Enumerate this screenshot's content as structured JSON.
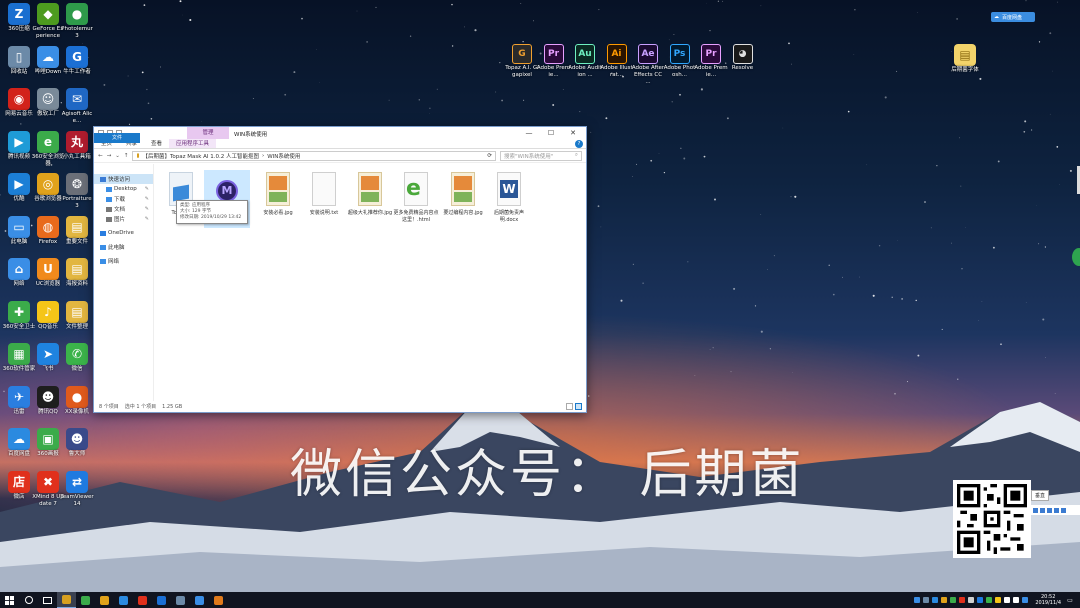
{
  "desktop": {
    "left_icons": [
      {
        "label": "360压缩",
        "color": "#1a6fd0",
        "glyph": "Z"
      },
      {
        "label": "GeForce Experience",
        "color": "#4d9b1f",
        "glyph": "◆"
      },
      {
        "label": "Photolemur 3",
        "color": "#2e9a4a",
        "glyph": "●"
      },
      {
        "label": "回收站",
        "color": "#6c8aa8",
        "glyph": "▯"
      },
      {
        "label": "哔哩Down",
        "color": "#3a8ee6",
        "glyph": "☁"
      },
      {
        "label": "牛牛工作者",
        "color": "#1b6fd4",
        "glyph": "G"
      },
      {
        "label": "网易云音乐",
        "color": "#d2221a",
        "glyph": "◉"
      },
      {
        "label": "傲软工厂",
        "color": "#7a8a99",
        "glyph": "☺"
      },
      {
        "label": "Agisoft Alice...",
        "color": "#1f67c4",
        "glyph": "✉"
      },
      {
        "label": "腾讯视频",
        "color": "#1e9bd7",
        "glyph": "▶"
      },
      {
        "label": "360安全浏览器",
        "color": "#3bab4a",
        "glyph": "e"
      },
      {
        "label": "小丸工具箱",
        "color": "#b01c2e",
        "glyph": "丸"
      },
      {
        "label": "优酷",
        "color": "#1c7fd6",
        "glyph": "▶"
      },
      {
        "label": "谷歌浏览器",
        "color": "#e0a21b",
        "glyph": "◎"
      },
      {
        "label": "Portraiture 3",
        "color": "#6b6f78",
        "glyph": "❂"
      },
      {
        "label": "此电脑",
        "color": "#3a8ee6",
        "glyph": "▭"
      },
      {
        "label": "Firefox",
        "color": "#e86a1c",
        "glyph": "◍"
      },
      {
        "label": "重要文件",
        "color": "#e2b640",
        "glyph": "▤"
      },
      {
        "label": "网络",
        "color": "#3a8ee6",
        "glyph": "⌂"
      },
      {
        "label": "UC浏览器",
        "color": "#f08a1c",
        "glyph": "U"
      },
      {
        "label": "海报资料",
        "color": "#e2b640",
        "glyph": "▤"
      },
      {
        "label": "360安全卫士",
        "color": "#3bab4a",
        "glyph": "✚"
      },
      {
        "label": "QQ音乐",
        "color": "#f5c518",
        "glyph": "♪"
      },
      {
        "label": "文件整理",
        "color": "#e2b640",
        "glyph": "▤"
      },
      {
        "label": "360软件管家",
        "color": "#3bab4a",
        "glyph": "▦"
      },
      {
        "label": "飞书",
        "color": "#1f83e0",
        "glyph": "➤"
      },
      {
        "label": "微信",
        "color": "#3bb34a",
        "glyph": "✆"
      },
      {
        "label": "迅雷",
        "color": "#2a7ee0",
        "glyph": "✈"
      },
      {
        "label": "腾讯QQ",
        "color": "#1e1e1e",
        "glyph": "☻"
      },
      {
        "label": "XX录像机",
        "color": "#e05a1c",
        "glyph": "●"
      },
      {
        "label": "百度网盘",
        "color": "#2b8ae0",
        "glyph": "☁"
      },
      {
        "label": "360画报",
        "color": "#3bab4a",
        "glyph": "▣"
      },
      {
        "label": "鲁大师",
        "color": "#3a4a8a",
        "glyph": "☻"
      },
      {
        "label": "微店",
        "color": "#e0301c",
        "glyph": "店"
      },
      {
        "label": "XMind 8 Update 7",
        "color": "#e0301c",
        "glyph": "✖"
      },
      {
        "label": "TeamViewer 14",
        "color": "#1f7ae0",
        "glyph": "⇄"
      }
    ],
    "adobe_icons": [
      {
        "label": "Topaz A.I. Gigapixel",
        "abbr": "G",
        "color": "#2a2a2a",
        "accent": "#f0a030"
      },
      {
        "label": "Adobe Premie...",
        "abbr": "Pr",
        "color": "#2a0a3a",
        "accent": "#e8a0ff"
      },
      {
        "label": "Adobe Audition ...",
        "abbr": "Au",
        "color": "#0a2a22",
        "accent": "#6ef0c0"
      },
      {
        "label": "Adobe Illustrat...",
        "abbr": "Ai",
        "color": "#2a1400",
        "accent": "#ff9a00"
      },
      {
        "label": "Adobe After Effects CC ...",
        "abbr": "Ae",
        "color": "#1a0a30",
        "accent": "#c9a0ff"
      },
      {
        "label": "Adobe Photosh...",
        "abbr": "Ps",
        "color": "#001a30",
        "accent": "#31a8ff"
      },
      {
        "label": "Adobe Premie...",
        "abbr": "Pr",
        "color": "#2a0a3a",
        "accent": "#e8a0ff"
      },
      {
        "label": "Resolve",
        "abbr": "◕",
        "color": "#1a1a1a",
        "accent": "#e0e0e0"
      }
    ],
    "right_icon": {
      "label": "后期菌字体",
      "glyph": "▤"
    }
  },
  "baidu": {
    "label": "百度网盘"
  },
  "explorer": {
    "manage_tab": "管理",
    "title": "WIN系统使用",
    "tabs": [
      "文件",
      "主页",
      "共享",
      "查看",
      "应用程序工具"
    ],
    "address": [
      "【后期菌】Topaz Mask AI 1.0.2 人工智能抠图",
      "WIN系统使用"
    ],
    "search_placeholder": "搜索\"WIN系统使用\"",
    "nav": [
      {
        "label": "快速访问",
        "color": "#3a7bd5",
        "pinned": false,
        "selected": true
      },
      {
        "label": "Desktop",
        "color": "#3a8ee6",
        "pinned": true,
        "selected": false
      },
      {
        "label": "下载",
        "color": "#3a8ee6",
        "pinned": true,
        "selected": false
      },
      {
        "label": "文档",
        "color": "#777777",
        "pinned": true,
        "selected": false
      },
      {
        "label": "图片",
        "color": "#777777",
        "pinned": true,
        "selected": false
      },
      {
        "label": "OneDrive",
        "color": "#2a7ee0",
        "pinned": false,
        "selected": false
      },
      {
        "label": "此电脑",
        "color": "#3a8ee6",
        "pinned": false,
        "selected": false
      },
      {
        "label": "网络",
        "color": "#3a8ee6",
        "pinned": false,
        "selected": false
      }
    ],
    "files": [
      {
        "name": "Topaz...",
        "kind": "setup"
      },
      {
        "name": "",
        "kind": "app"
      },
      {
        "name": "安装必看.jpg",
        "kind": "image"
      },
      {
        "name": "安装说明.txt",
        "kind": "text"
      },
      {
        "name": "超级大礼推荐你.jpg",
        "kind": "image"
      },
      {
        "name": "更多免费精品内容点这里！.html",
        "kind": "html"
      },
      {
        "name": "要过编程内容.jpg",
        "kind": "image"
      },
      {
        "name": "后期菌免责声明.docx",
        "kind": "docx"
      }
    ],
    "tooltip": [
      "类型: 应用程序",
      "大小: 129 字节",
      "修改日期: 2019/10/29 13:42"
    ],
    "status": [
      "8 个项目",
      "选中 1 个项目",
      "1.25 GB"
    ]
  },
  "watermark": "微信公众号：  后期菌",
  "qr_tip": "垂直",
  "clock": {
    "time": "20:52",
    "date": "2019/11/4"
  },
  "taskbar": {
    "apps": [
      {
        "color": "#d8a020",
        "active": true
      },
      {
        "color": "#3bab4a",
        "active": false
      },
      {
        "color": "#e0a21b",
        "active": false
      },
      {
        "color": "#2b8ae0",
        "active": false
      },
      {
        "color": "#e0301c",
        "active": false
      },
      {
        "color": "#1b6fd4",
        "active": false
      },
      {
        "color": "#6c8aa8",
        "active": false
      },
      {
        "color": "#3a8ee6",
        "active": false
      },
      {
        "color": "#e07a1c",
        "active": false
      }
    ]
  }
}
